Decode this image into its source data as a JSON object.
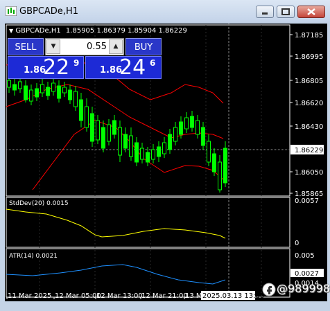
{
  "window": {
    "title": "GBPCADe,H1",
    "minimize_icon": "minimize-icon",
    "maximize_icon": "maximize-icon",
    "close_icon": "close-icon"
  },
  "chart_header": {
    "symbol": "GBPCADe,H1",
    "ohlc": "1.85905 1.86379 1.85904 1.86229"
  },
  "one_click": {
    "sell_label": "SELL",
    "buy_label": "BUY",
    "lot": "0.55",
    "bid_prefix": "1.86",
    "bid_big": "22",
    "bid_sup": "9",
    "ask_prefix": "1.86",
    "ask_big": "24",
    "ask_sup": "6"
  },
  "price_axis": {
    "ticks": [
      "1.87185",
      "1.86995",
      "1.86805",
      "1.86620",
      "1.86430",
      "1.86050",
      "1.85865"
    ],
    "current": "1.86229"
  },
  "stddev": {
    "label": "StdDev(20) 0.0015",
    "ticks": [
      "0.0057",
      "0"
    ]
  },
  "atr": {
    "label": "ATR(14) 0.0021",
    "ticks": [
      "0.005",
      "0.0027",
      "0.0014"
    ]
  },
  "time_axis": {
    "labels": [
      "11 Mar 2025",
      "12 Mar 05:00",
      "12 Mar 13:00",
      "12 Mar 21:00",
      "13 Ma"
    ],
    "crosshair": "2025.03.13 13:00"
  },
  "watermark": "@989998",
  "colors": {
    "background": "#000000",
    "candle": "#00ff00",
    "bollinger": "#ff0000",
    "stddev_line": "#ffff00",
    "atr_line": "#1e90ff",
    "trade_button": "#2a37c8",
    "price_box": "#1d2ad6"
  }
}
